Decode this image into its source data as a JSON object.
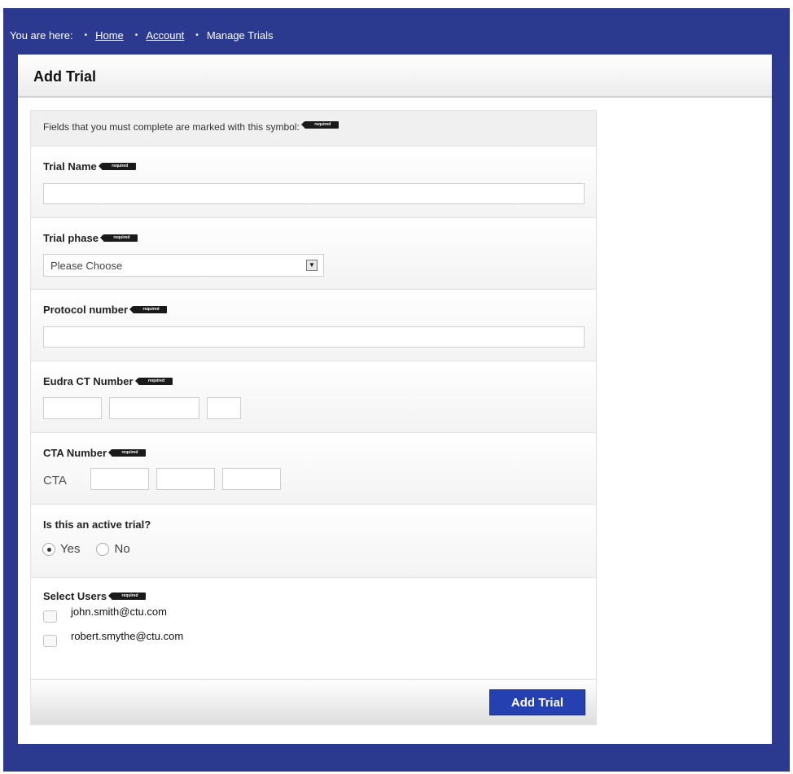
{
  "breadcrumb": {
    "prefix": "You are here:",
    "items": [
      {
        "label": "Home"
      },
      {
        "label": "Account"
      },
      {
        "label": "Manage Trials"
      }
    ]
  },
  "panel": {
    "title": "Add Trial"
  },
  "form": {
    "notice": "Fields that you must complete are marked with this symbol:",
    "required_badge": "required",
    "trial_name": {
      "label": "Trial Name",
      "value": ""
    },
    "trial_phase": {
      "label": "Trial phase",
      "selected": "Please Choose"
    },
    "protocol_number": {
      "label": "Protocol number",
      "value": ""
    },
    "eudra_ct": {
      "label": "Eudra CT Number",
      "parts": [
        "",
        "",
        ""
      ]
    },
    "cta_number": {
      "label": "CTA Number",
      "prefix": "CTA",
      "parts": [
        "",
        "",
        ""
      ]
    },
    "active_trial": {
      "label": "Is this an active trial?",
      "options": [
        {
          "label": "Yes",
          "checked": true
        },
        {
          "label": "No",
          "checked": false
        }
      ]
    },
    "users": {
      "label": "Select Users",
      "items": [
        {
          "email": "john.smith@ctu.com",
          "checked": false
        },
        {
          "email": "robert.smythe@ctu.com",
          "checked": false
        }
      ]
    },
    "submit_label": "Add Trial"
  },
  "colors": {
    "frame": "#2b3a8f",
    "button": "#2540b0"
  }
}
